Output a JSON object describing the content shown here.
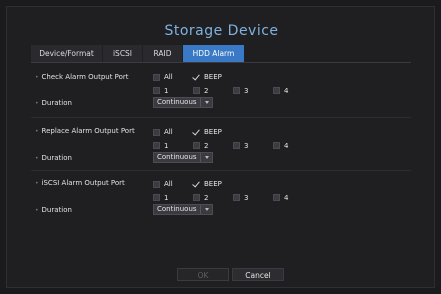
{
  "title": "Storage Device",
  "tabs": [
    {
      "label": "Device/Format",
      "active": false
    },
    {
      "label": "iSCSI",
      "active": false
    },
    {
      "label": "RAID",
      "active": false
    },
    {
      "label": "HDD Alarm",
      "active": true
    }
  ],
  "sections": [
    {
      "port_label": "Check Alarm Output Port",
      "duration_label": "Duration",
      "all_label": "All",
      "all_checked": false,
      "beep_label": "BEEP",
      "beep_checked": true,
      "ports": [
        "1",
        "2",
        "3",
        "4"
      ],
      "duration_value": "Continuous"
    },
    {
      "port_label": "Replace Alarm Output Port",
      "duration_label": "Duration",
      "all_label": "All",
      "all_checked": false,
      "beep_label": "BEEP",
      "beep_checked": true,
      "ports": [
        "1",
        "2",
        "3",
        "4"
      ],
      "duration_value": "Continuous"
    },
    {
      "port_label": "iSCSI Alarm Output Port",
      "duration_label": "Duration",
      "all_label": "All",
      "all_checked": false,
      "beep_label": "BEEP",
      "beep_checked": true,
      "ports": [
        "1",
        "2",
        "3",
        "4"
      ],
      "duration_value": "Continuous"
    }
  ],
  "footer": {
    "ok_label": "OK",
    "cancel_label": "Cancel"
  },
  "colors": {
    "accent": "#3a79c6",
    "title": "#7fb2e0",
    "background": "#1f1f22"
  }
}
